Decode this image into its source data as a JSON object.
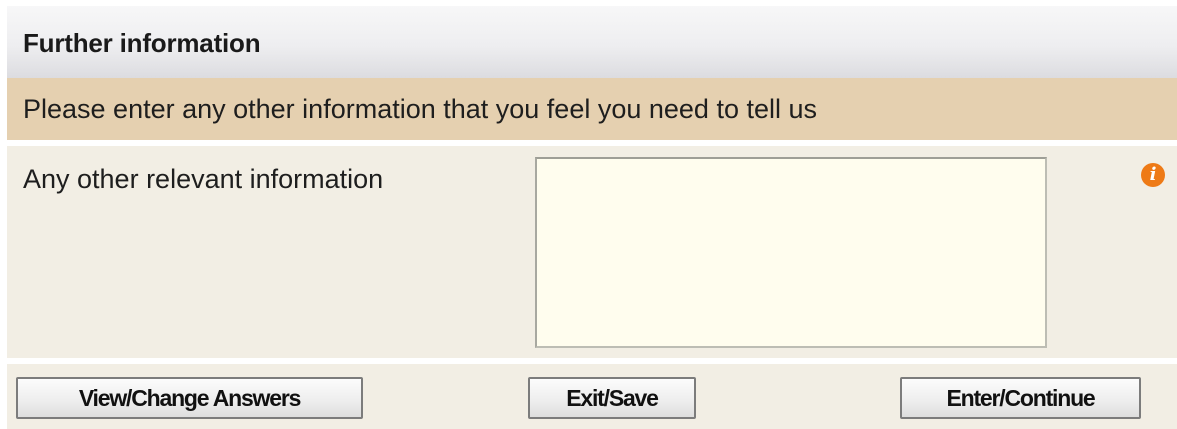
{
  "header": {
    "title": "Further information"
  },
  "intro": {
    "text": "Please enter any other information that you feel you need to tell us"
  },
  "question": {
    "label": "Any other relevant information",
    "answer_value": "",
    "info_icon": "info-icon",
    "info_glyph": "i"
  },
  "buttons": {
    "view_change": "View/Change Answers",
    "exit_save": "Exit/Save",
    "enter_continue": "Enter/Continue"
  },
  "colors": {
    "intro_background": "#e5d0b0",
    "panel_background": "#f2eee4",
    "answer_background": "#fffdee",
    "info_icon": "#ee7a16"
  }
}
